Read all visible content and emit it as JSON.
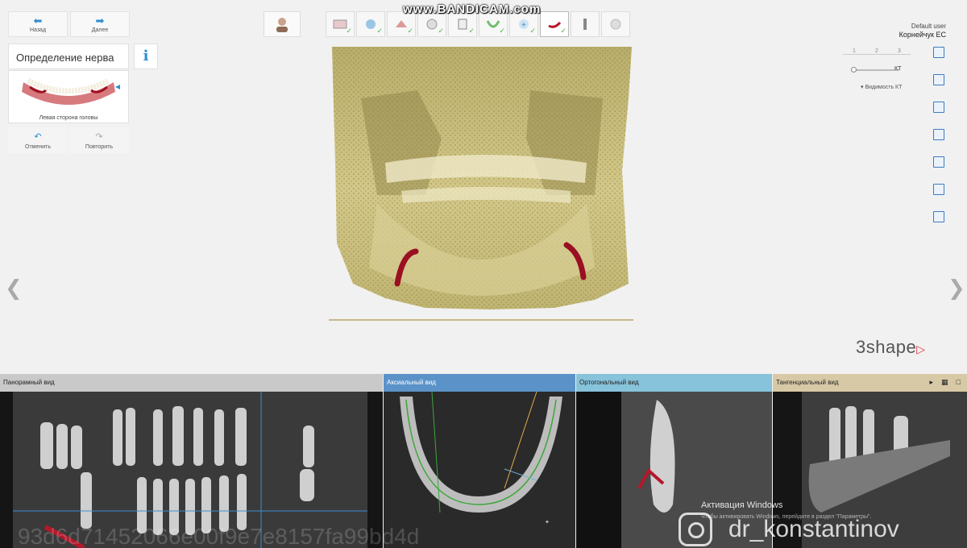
{
  "nav": {
    "back_label": "Назад",
    "next_label": "Далее"
  },
  "panel": {
    "title": "Определение нерва",
    "info_label": "i",
    "thumbnail_caption": "Левая сторона головы",
    "undo_label": "Отменить",
    "redo_label": "Повторить"
  },
  "recording_watermark": "www.BANDICAM.com",
  "user": {
    "line1": "Default user",
    "line2": "Корнейчук ЕС"
  },
  "view_controls": {
    "segments": [
      "1",
      "2",
      "3"
    ],
    "slider_label": "КТ",
    "visibility_label": "Видимость КТ"
  },
  "brand": "3shape",
  "bottom_views": {
    "panoramic": "Панорамный вид",
    "axial": "Аксиальный вид",
    "orthogonal": "Ортогональный вид",
    "tangential": "Тангенциальный вид"
  },
  "overlays": {
    "hash": "93d6d71452066e00f9e7e8157fa99bd4d",
    "windows_activation": "Активация Windows",
    "windows_activation_sub": "Чтобы активировать Windows, перейдите в раздел \"Параметры\".",
    "instagram_handle": "dr_konstantinov"
  },
  "colors": {
    "accent": "#2d8ed1",
    "check": "#49b84a",
    "nerve": "#b3182b",
    "brand_triangle": "#d7333a"
  },
  "icons": [
    "arrow-left-icon",
    "arrow-right-icon",
    "undo-icon",
    "redo-icon",
    "info-icon",
    "patient-icon",
    "check-icon",
    "instagram-icon"
  ]
}
